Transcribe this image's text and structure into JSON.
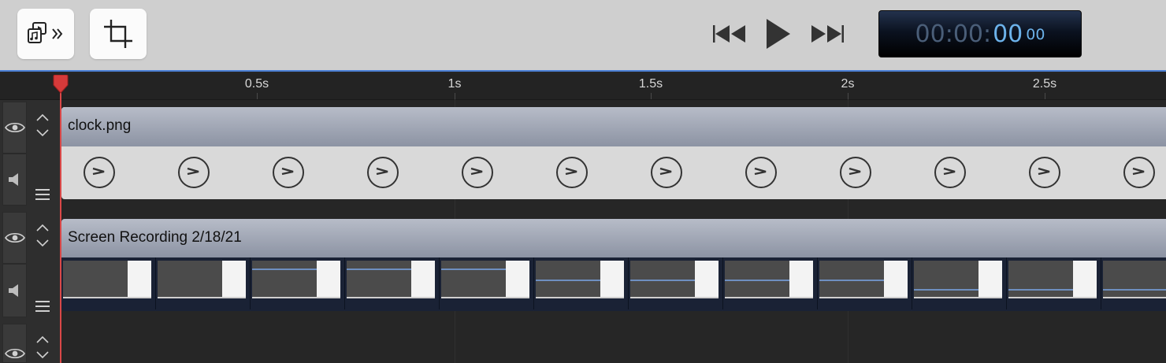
{
  "toolbar": {
    "media_button_icon": "media-library-icon",
    "crop_button_icon": "crop-icon",
    "transport": {
      "rewind_icon": "skip-back-icon",
      "play_icon": "play-icon",
      "forward_icon": "skip-forward-icon"
    },
    "timecode": {
      "dim": "00:00:",
      "bright": "00",
      "frames": "00"
    }
  },
  "ruler": {
    "ticks": [
      "0.5s",
      "1s",
      "1.5s",
      "2s",
      "2.5s"
    ]
  },
  "tracks": [
    {
      "title": "clock.png"
    },
    {
      "title": "Screen Recording 2/18/21"
    }
  ],
  "colors": {
    "accent": "#4a7fd6",
    "playhead": "#d94848",
    "timecode_text": "#6cb2ea"
  }
}
